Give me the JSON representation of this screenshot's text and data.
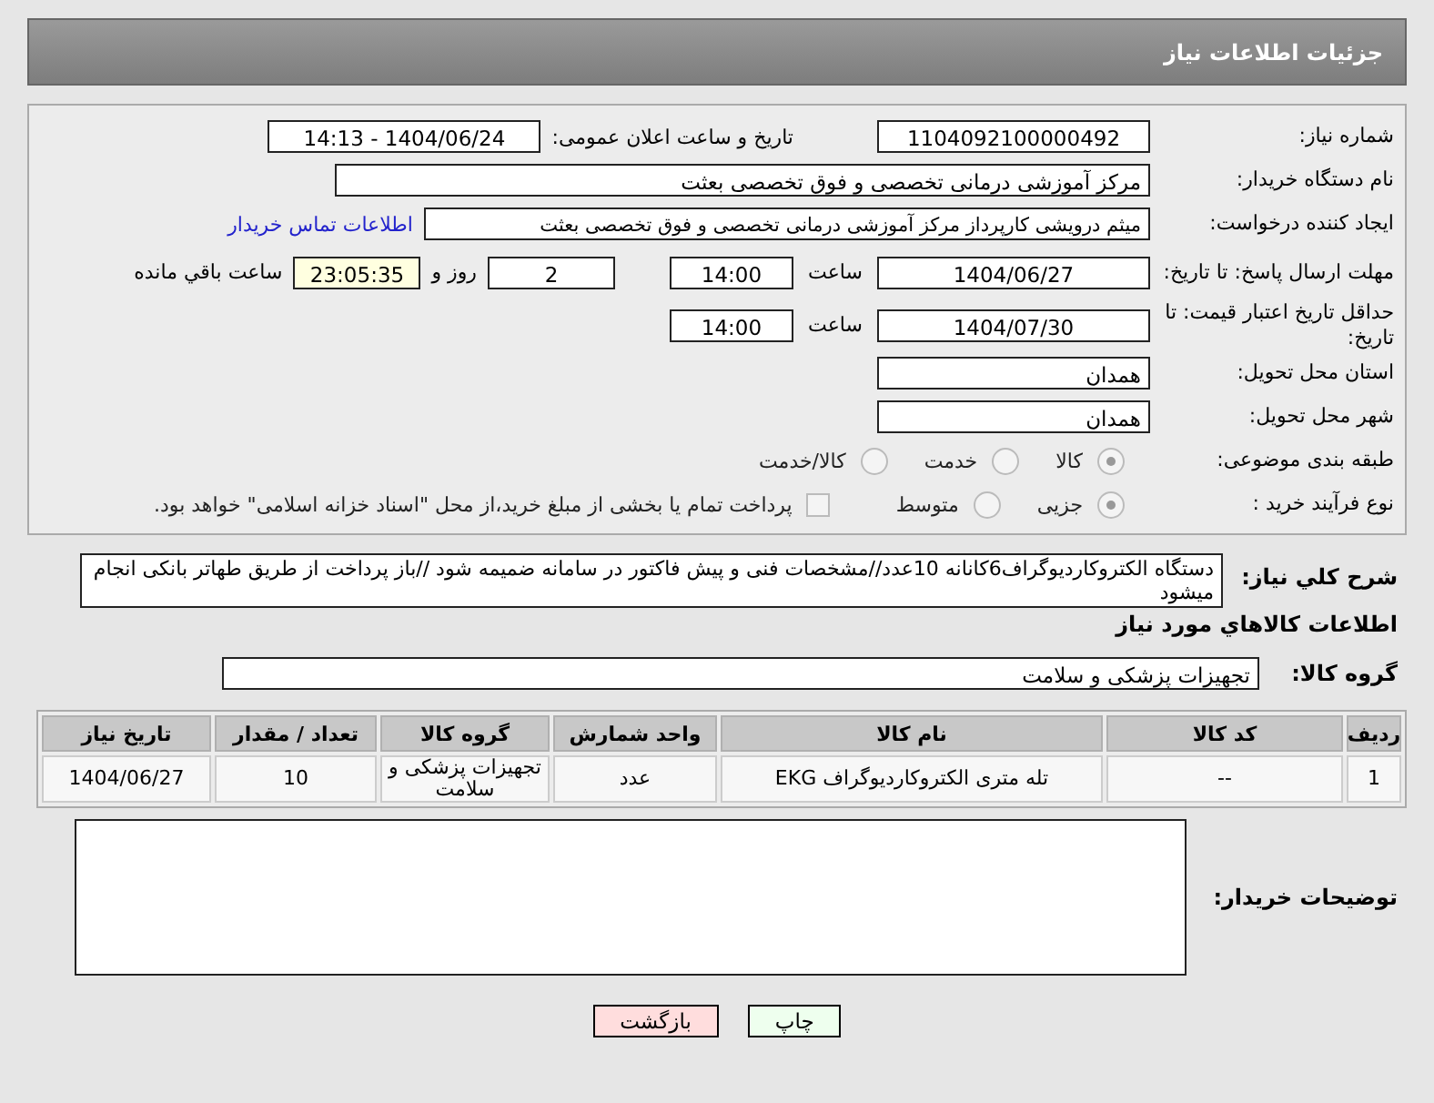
{
  "header": {
    "title": "جزئیات اطلاعات نیاز"
  },
  "need_number": {
    "label": "شماره نیاز:",
    "value": "1104092100000492"
  },
  "announce": {
    "label": "تاریخ و ساعت اعلان عمومی:",
    "value": "1404/06/24 - 14:13"
  },
  "buyer_org": {
    "label": "نام دستگاه خریدار:",
    "value": "مرکز آموزشی درمانی تخصصی و فوق تخصصی بعثت"
  },
  "requester": {
    "label": "ایجاد کننده درخواست:",
    "value": "میثم درویشی کارپرداز مرکز آموزشی درمانی تخصصی و فوق تخصصی بعثت",
    "link": "اطلاعات تماس خریدار"
  },
  "reply_deadline": {
    "label": "مهلت ارسال پاسخ: تا تاریخ:",
    "date": "1404/06/27",
    "time_label": "ساعت",
    "time": "14:00",
    "days": "2",
    "days_label": "روز و",
    "remaining": "23:05:35",
    "remaining_label": "ساعت باقي مانده"
  },
  "price_validity": {
    "label": "حداقل تاریخ اعتبار قیمت: تا تاریخ:",
    "date": "1404/07/30",
    "time_label": "ساعت",
    "time": "14:00"
  },
  "province": {
    "label": "استان محل تحویل:",
    "value": "همدان"
  },
  "city": {
    "label": "شهر محل تحویل:",
    "value": "همدان"
  },
  "category": {
    "label": "طبقه بندی موضوعی:",
    "options": [
      {
        "label": "کالا",
        "selected": true
      },
      {
        "label": "خدمت",
        "selected": false
      },
      {
        "label": "کالا/خدمت",
        "selected": false
      }
    ]
  },
  "purchase_type": {
    "label": "نوع فرآیند خرید :",
    "options": [
      {
        "label": "جزیی",
        "selected": true
      },
      {
        "label": "متوسط",
        "selected": false
      }
    ],
    "payment": {
      "label": "پرداخت تمام یا بخشی از مبلغ خرید،از محل \"اسناد خزانه اسلامی\" خواهد بود.",
      "checked": false
    }
  },
  "description": {
    "label": "شرح کلي نياز:",
    "value": "دستگاه الکتروکاردیوگراف6کانانه   10عدد//مشخصات فنی و پیش فاکتور در سامانه ضمیمه شود //باز پرداخت از طریق طهاتر بانکی انجام میشود"
  },
  "goods_title": "اطلاعات کالاهاي مورد نياز",
  "goods_group": {
    "label": "گروه کالا:",
    "value": "تجهیزات پزشکی و سلامت"
  },
  "table": {
    "columns": [
      "ردیف",
      "کد کالا",
      "نام کالا",
      "واحد شمارش",
      "گروه کالا",
      "تعداد / مقدار",
      "تاریخ نیاز"
    ],
    "rows": [
      [
        "1",
        "--",
        "تله متری الکتروکاردیوگراف EKG",
        "عدد",
        "تجهیزات پزشکی و سلامت",
        "10",
        "1404/06/27"
      ]
    ]
  },
  "buyer_notes": {
    "label": "توضیحات خریدار:"
  },
  "buttons": [
    {
      "label": "چاپ",
      "kind": "print"
    },
    {
      "label": "بازگشت",
      "kind": "back"
    }
  ]
}
